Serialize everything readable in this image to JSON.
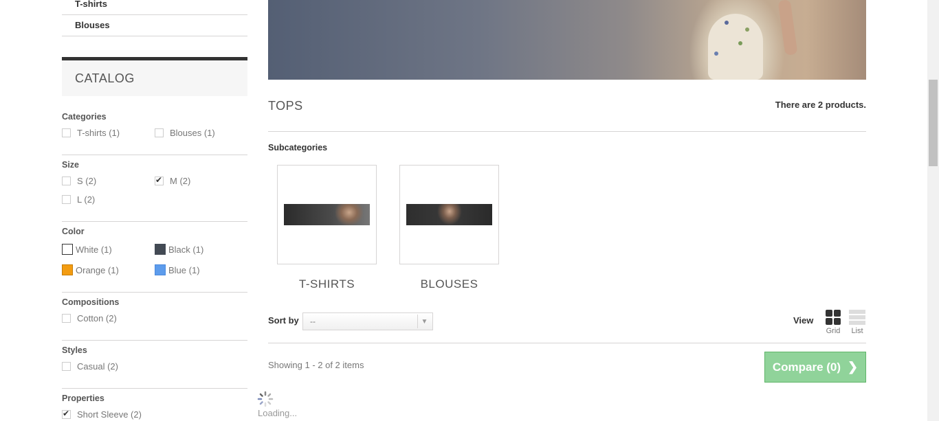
{
  "sidebar": {
    "sub_links": [
      "T-shirts",
      "Blouses"
    ],
    "catalog_title": "CATALOG",
    "groups": {
      "categories": {
        "title": "Categories",
        "options": [
          {
            "label": "T-shirts (1)",
            "checked": false
          },
          {
            "label": "Blouses (1)",
            "checked": false
          }
        ]
      },
      "size": {
        "title": "Size",
        "options": [
          {
            "label": "S (2)",
            "checked": false
          },
          {
            "label": "M (2)",
            "checked": true
          },
          {
            "label": "L (2)",
            "checked": false
          }
        ]
      },
      "color": {
        "title": "Color",
        "options": [
          {
            "label": "White (1)",
            "color": "#ffffff"
          },
          {
            "label": "Black (1)",
            "color": "#434a54"
          },
          {
            "label": "Orange (1)",
            "color": "#f39c11"
          },
          {
            "label": "Blue (1)",
            "color": "#5d9cec"
          }
        ]
      },
      "compositions": {
        "title": "Compositions",
        "options": [
          {
            "label": "Cotton (2)",
            "checked": false
          }
        ]
      },
      "styles": {
        "title": "Styles",
        "options": [
          {
            "label": "Casual (2)",
            "checked": false
          }
        ]
      },
      "properties": {
        "title": "Properties",
        "options": [
          {
            "label": "Short Sleeve (2)",
            "checked": true
          }
        ]
      }
    }
  },
  "main": {
    "category_title": "TOPS",
    "product_count": "There are 2 products.",
    "subcategories_label": "Subcategories",
    "subcategories": [
      {
        "name": "T-SHIRTS"
      },
      {
        "name": "BLOUSES"
      }
    ],
    "sort": {
      "label": "Sort by",
      "value": "--"
    },
    "view": {
      "label": "View",
      "grid": "Grid",
      "list": "List"
    },
    "showing": "Showing 1 - 2 of 2 items",
    "compare_button": "Compare (0)",
    "loading": "Loading..."
  },
  "colors": {
    "compare_bg": "#90d39a",
    "accent_dark": "#333333"
  },
  "icons": [
    "check-icon",
    "chevron-down-icon",
    "grid-icon",
    "list-icon",
    "chevron-right-icon",
    "spinner-icon"
  ]
}
